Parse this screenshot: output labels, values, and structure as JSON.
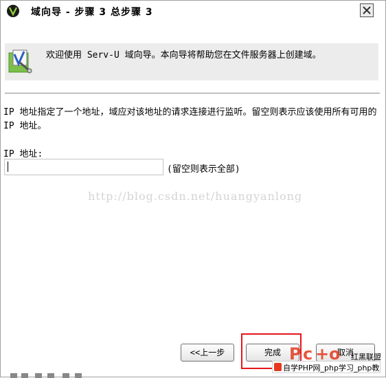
{
  "window": {
    "title": "域向导 - 步骤 3 总步骤 3"
  },
  "banner": {
    "text": "欢迎使用 Serv-U 域向导。本向导将帮助您在文件服务器上创建域。"
  },
  "content": {
    "description": "IP 地址指定了一个地址，域应对该地址的请求连接进行监听。留空则表示应该使用所有可用的 IP 地址。",
    "ip_label": "IP 地址:",
    "ip_value": "",
    "ip_hint": "(留空则表示全部)"
  },
  "watermark": "http://blog.csdn.net/huangyanlong",
  "buttons": {
    "back_label": "<<上一步",
    "finish_label": "完成",
    "cancel_label": "取消"
  },
  "overlay": {
    "logo_text": "红黑联盟",
    "footer_text": "自学PHP网_php学习_php教"
  },
  "colors": {
    "highlight": "#e6151c",
    "banner_bg": "#ececec"
  },
  "icons": {
    "title": "serv-u-logo-icon",
    "banner": "wizard-icon",
    "close": "close-icon"
  }
}
